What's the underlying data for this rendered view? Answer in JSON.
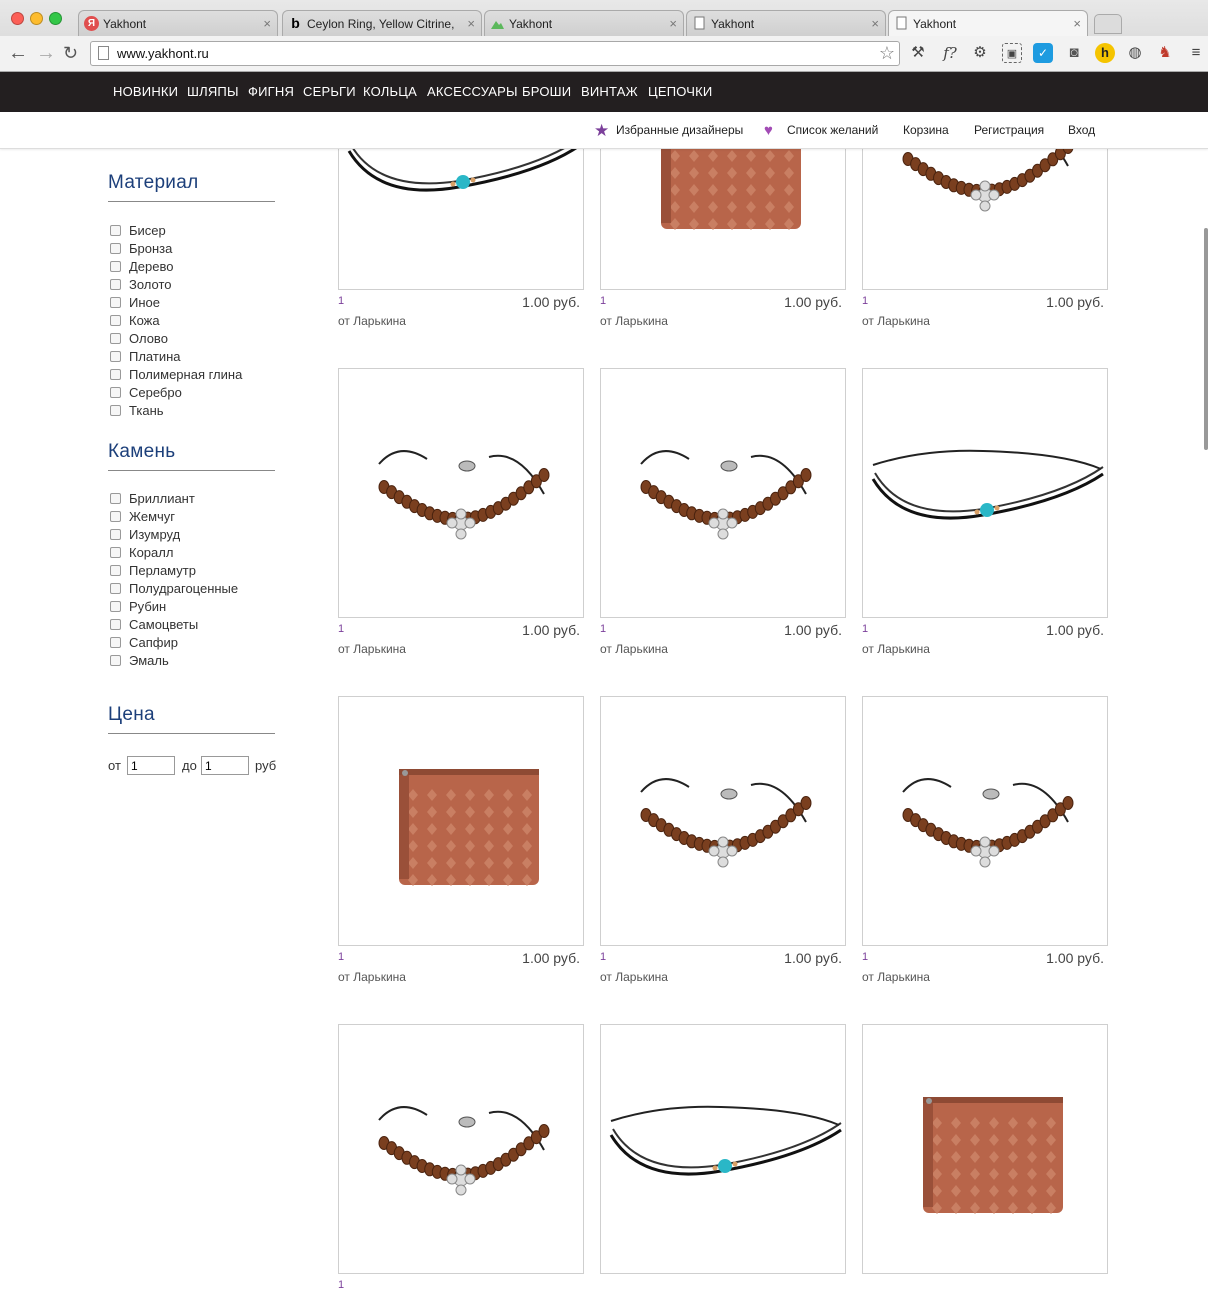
{
  "browser": {
    "tabs": [
      {
        "title": "Yakhont",
        "icon": "yakhont-red-icon"
      },
      {
        "title": "Ceylon Ring, Yellow Citrine,",
        "icon": "b-letter-icon"
      },
      {
        "title": "Yakhont",
        "icon": "mountain-icon"
      },
      {
        "title": "Yakhont",
        "icon": "page-icon"
      },
      {
        "title": "Yakhont",
        "icon": "page-icon"
      }
    ],
    "url": "www.yakhont.ru",
    "extensions": [
      "wrench-icon",
      "f-question-icon",
      "gear-icon",
      "evernote-icon",
      "message-icon",
      "pocket-icon",
      "h-badge-icon",
      "globe-icon",
      "sofa-icon",
      "menu-icon"
    ]
  },
  "site_nav": [
    "НОВИНКИ",
    "ШЛЯПЫ",
    "ФИГНЯ",
    "СЕРЬГИ",
    "КОЛЬЦА",
    "АКСЕССУАРЫ",
    "БРОШИ",
    "ВИНТАЖ",
    "ЦЕПОЧКИ"
  ],
  "user_bar": {
    "favorite_designers": "Избранные дизайнеры",
    "wishlist": "Список желаний",
    "cart": "Корзина",
    "register": "Регистрация",
    "login": "Вход"
  },
  "filters": {
    "material": {
      "title": "Материал",
      "options": [
        "Бисер",
        "Бронза",
        "Дерево",
        "Золото",
        "Иное",
        "Кожа",
        "Олово",
        "Платина",
        "Полимерная глина",
        "Серебро",
        "Ткань"
      ]
    },
    "stone": {
      "title": "Камень",
      "options": [
        "Бриллиант",
        "Жемчуг",
        "Изумруд",
        "Коралл",
        "Перламутр",
        "Полудрагоценные",
        "Рубин",
        "Самоцветы",
        "Сапфир",
        "Эмаль"
      ]
    },
    "price": {
      "title": "Цена",
      "from_label": "от",
      "to_label": "до",
      "currency": "руб",
      "from_value": "1",
      "to_value": "1"
    }
  },
  "products": [
    {
      "image": "bracelet-cord-turquoise",
      "num": "1",
      "price": "1.00 руб.",
      "designer": "от Ларькина"
    },
    {
      "image": "leather-pouch",
      "num": "1",
      "price": "1.00 руб.",
      "designer": "от Ларькина"
    },
    {
      "image": "bracelet-beads-cross",
      "num": "1",
      "price": "1.00 руб.",
      "designer": "от Ларькина"
    },
    {
      "image": "bracelet-beads-cross",
      "num": "1",
      "price": "1.00 руб.",
      "designer": "от Ларькина"
    },
    {
      "image": "bracelet-beads-cross",
      "num": "1",
      "price": "1.00 руб.",
      "designer": "от Ларькина"
    },
    {
      "image": "bracelet-cord-turquoise",
      "num": "1",
      "price": "1.00 руб.",
      "designer": "от Ларькина"
    },
    {
      "image": "leather-pouch",
      "num": "1",
      "price": "1.00 руб.",
      "designer": "от Ларькина"
    },
    {
      "image": "bracelet-beads-cross",
      "num": "1",
      "price": "1.00 руб.",
      "designer": "от Ларькина"
    },
    {
      "image": "bracelet-beads-cross",
      "num": "1",
      "price": "1.00 руб.",
      "designer": "от Ларькина"
    },
    {
      "image": "bracelet-beads-cross",
      "num": "1",
      "price": "",
      "designer": ""
    },
    {
      "image": "bracelet-cord-turquoise",
      "num": "",
      "price": "",
      "designer": ""
    },
    {
      "image": "leather-pouch",
      "num": "",
      "price": "",
      "designer": ""
    }
  ],
  "colors": {
    "nav_bg": "#231f20",
    "accent": "#7b3f9a",
    "heading": "#1c3f7a",
    "leather": "#b8654a"
  }
}
